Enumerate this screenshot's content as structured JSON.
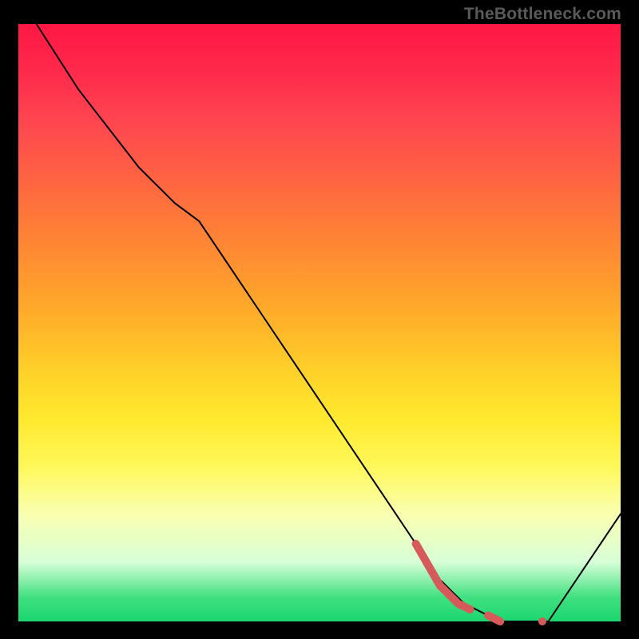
{
  "attribution": "TheBottleneck.com",
  "chart_data": {
    "type": "line",
    "title": "",
    "xlabel": "",
    "ylabel": "",
    "xlim": [
      0,
      100
    ],
    "ylim": [
      0,
      100
    ],
    "series": [
      {
        "name": "main-curve",
        "color": "#000000",
        "stroke_width": 2,
        "x": [
          3,
          10,
          20,
          26,
          30,
          40,
          50,
          60,
          66,
          70,
          74,
          80,
          84,
          88,
          100
        ],
        "y": [
          100,
          89,
          76,
          70,
          67,
          52,
          37,
          22,
          13,
          7,
          3,
          0,
          0,
          0,
          18
        ]
      },
      {
        "name": "highlight-segment",
        "color": "#d65a5a",
        "stroke_width": 10,
        "style": "solid-then-dashed",
        "x": [
          66,
          70,
          73,
          75,
          78,
          80,
          83,
          85,
          87
        ],
        "y": [
          13,
          6,
          3,
          2,
          1,
          0,
          0,
          0,
          0
        ]
      }
    ]
  }
}
